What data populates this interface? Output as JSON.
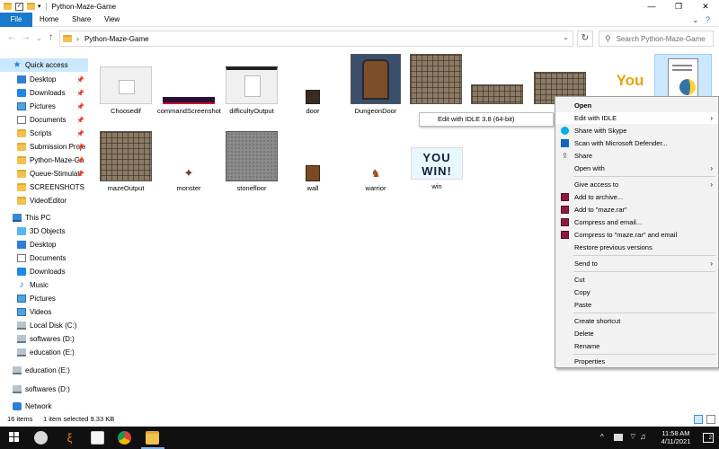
{
  "window": {
    "title": "Python-Maze-Game",
    "minimize_glyph": "—",
    "maximize_glyph": "❐",
    "close_glyph": "✕"
  },
  "ribbon": {
    "tabs": [
      "File",
      "Home",
      "Share",
      "View"
    ],
    "collapse_glyph": "⌄",
    "help_glyph": "?"
  },
  "address": {
    "back_glyph": "←",
    "forward_glyph": "→",
    "recent_glyph": "⌄",
    "up_glyph": "↑",
    "separator": "›",
    "path": "Python-Maze-Game",
    "dropdown_glyph": "⌄",
    "refresh_glyph": "↻",
    "search_glyph": "⚲",
    "search_placeholder": "Search Python-Maze-Game"
  },
  "nav": {
    "quick_access": "Quick access",
    "pinned": [
      "Desktop",
      "Downloads",
      "Pictures",
      "Documents",
      "Scripts",
      "Submission Proje",
      "Python-Maze-Ga",
      "Queue-Stimulati"
    ],
    "unpinned": [
      "SCREENSHOTS",
      "VideoEditor"
    ],
    "this_pc": "This PC",
    "pc_items": [
      "3D Objects",
      "Desktop",
      "Documents",
      "Downloads",
      "Music",
      "Pictures",
      "Videos",
      "Local Disk (C:)",
      "softwares (D:)",
      "education (E:)"
    ],
    "drives": [
      "education (E:)",
      "softwares (D:)"
    ],
    "network": "Network",
    "pin_glyph": "📌"
  },
  "files": [
    {
      "name": "Choosedif"
    },
    {
      "name": "commandScreenshot"
    },
    {
      "name": "difficultyOutput"
    },
    {
      "name": "door"
    },
    {
      "name": "DungeonDoor"
    },
    {
      "name": "mazeOutput"
    },
    {
      "name": "monster"
    },
    {
      "name": "stonefloor"
    },
    {
      "name": "wall"
    },
    {
      "name": "warrior"
    },
    {
      "name": "win"
    }
  ],
  "thumb_text": {
    "win_line1": "YOU",
    "win_line2": "WIN!",
    "you_partial": "You"
  },
  "tooltip": "Edit with IDLE 3.8 (64-bit)",
  "context_menu": {
    "open": "Open",
    "edit_with_idle": "Edit with IDLE",
    "share_with_skype": "Share with Skype",
    "scan_defender": "Scan with Microsoft Defender...",
    "share": "Share",
    "open_with": "Open with",
    "give_access": "Give access to",
    "add_archive": "Add to archive...",
    "add_maze_rar": "Add to \"maze.rar\"",
    "compress_email": "Compress and email...",
    "compress_maze_email": "Compress to \"maze.rar\" and email",
    "restore_versions": "Restore previous versions",
    "send_to": "Send to",
    "cut": "Cut",
    "copy": "Copy",
    "paste": "Paste",
    "create_shortcut": "Create shortcut",
    "delete": "Delete",
    "rename": "Rename",
    "properties": "Properties",
    "arrow_glyph": "›"
  },
  "status": {
    "count": "16 items",
    "selection": "1 item selected  9.33 KB"
  },
  "taskbar": {
    "tray_chevron": "^",
    "time": "11:58 AM",
    "date": "4/11/2021",
    "notifications": "2"
  }
}
